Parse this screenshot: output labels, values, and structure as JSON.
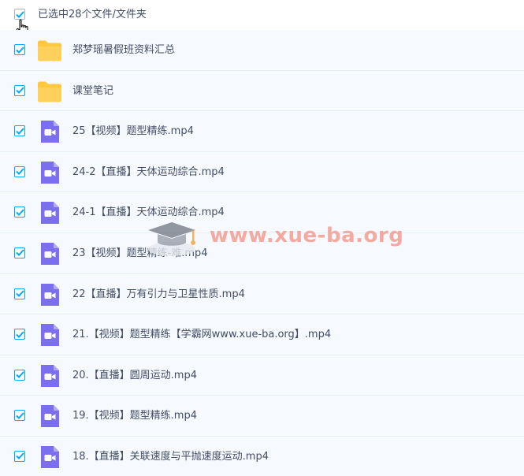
{
  "header": {
    "selected_label": "已选中28个文件/文件夹"
  },
  "files": [
    {
      "name": "郑梦瑶暑假班资料汇总",
      "type": "folder"
    },
    {
      "name": "课堂笔记",
      "type": "folder"
    },
    {
      "name": "25【视频】题型精练.mp4",
      "type": "video"
    },
    {
      "name": "24-2【直播】天体运动综合.mp4",
      "type": "video"
    },
    {
      "name": "24-1【直播】天体运动综合.mp4",
      "type": "video"
    },
    {
      "name": "23【视频】题型精练-难.mp4",
      "type": "video"
    },
    {
      "name": "22【直播】万有引力与卫星性质.mp4",
      "type": "video"
    },
    {
      "name": "21.【视频】题型精练【学霸网www.xue-ba.org】.mp4",
      "type": "video"
    },
    {
      "name": "20.【直播】圆周运动.mp4",
      "type": "video"
    },
    {
      "name": "19.【视频】题型精练.mp4",
      "type": "video"
    },
    {
      "name": "18.【直播】关联速度与平抛速度运动.mp4",
      "type": "video"
    }
  ],
  "watermark": {
    "text": "www.xue-ba.org"
  },
  "colors": {
    "accent": "#06a7ff",
    "folder": "#ffc83d",
    "video": "#7b6ff0",
    "text": "#424e67"
  }
}
